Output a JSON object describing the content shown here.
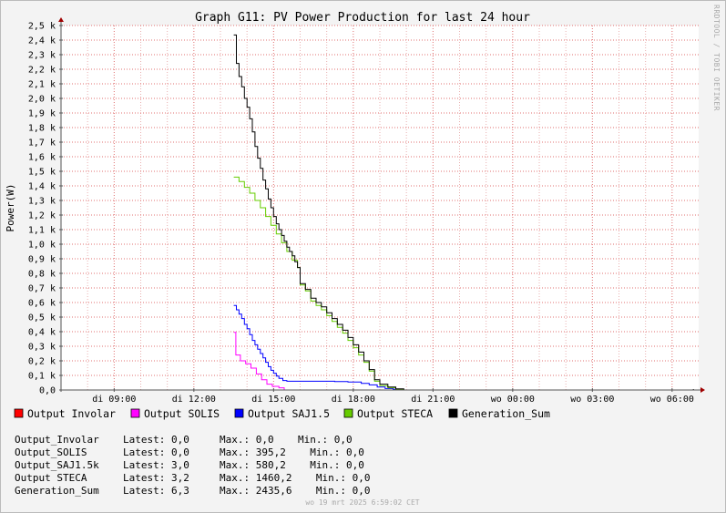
{
  "chart_data": {
    "type": "line",
    "title": "Graph G11: PV Power Production for last 24 hour",
    "ylabel": "Power(W)",
    "xlabel": "",
    "ylim": [
      0,
      2500
    ],
    "y_ticks": [
      0,
      100,
      200,
      300,
      400,
      500,
      600,
      700,
      800,
      900,
      1000,
      1100,
      1200,
      1300,
      1400,
      1500,
      1600,
      1700,
      1800,
      1900,
      2000,
      2100,
      2200,
      2300,
      2400,
      2500
    ],
    "y_tick_labels": [
      "0,0",
      "0,1 k",
      "0,2 k",
      "0,3 k",
      "0,4 k",
      "0,5 k",
      "0,6 k",
      "0,7 k",
      "0,8 k",
      "0,9 k",
      "1,0 k",
      "1,1 k",
      "1,2 k",
      "1,3 k",
      "1,4 k",
      "1,5 k",
      "1,6 k",
      "1,7 k",
      "1,8 k",
      "1,9 k",
      "2,0 k",
      "2,1 k",
      "2,2 k",
      "2,3 k",
      "2,4 k",
      "2,5 k"
    ],
    "x_unit": "hours since di 07:00",
    "xlim": [
      0,
      24
    ],
    "x_ticks": [
      2,
      5,
      8,
      11,
      14,
      17,
      20,
      23
    ],
    "x_tick_labels": [
      "di 09:00",
      "di 12:00",
      "di 15:00",
      "di 18:00",
      "di 21:00",
      "wo 00:00",
      "wo 03:00",
      "wo 06:00"
    ],
    "grid": true,
    "legend_position": "bottom",
    "series": [
      {
        "name": "Output_Involar",
        "color": "#ff0000",
        "points": [
          [
            6.5,
            0
          ],
          [
            24,
            0
          ]
        ]
      },
      {
        "name": "Output SOLIS",
        "color": "#ff00ff",
        "points": [
          [
            6.5,
            395
          ],
          [
            6.58,
            240
          ],
          [
            6.75,
            200
          ],
          [
            6.95,
            180
          ],
          [
            7.15,
            150
          ],
          [
            7.35,
            110
          ],
          [
            7.55,
            70
          ],
          [
            7.75,
            40
          ],
          [
            7.95,
            25
          ],
          [
            8.2,
            15
          ],
          [
            8.4,
            0
          ]
        ]
      },
      {
        "name": "Output SAJ1.5",
        "color": "#0000ff",
        "points": [
          [
            6.5,
            580
          ],
          [
            6.6,
            550
          ],
          [
            6.7,
            520
          ],
          [
            6.8,
            490
          ],
          [
            6.9,
            450
          ],
          [
            7.0,
            420
          ],
          [
            7.1,
            380
          ],
          [
            7.2,
            340
          ],
          [
            7.3,
            310
          ],
          [
            7.4,
            280
          ],
          [
            7.5,
            250
          ],
          [
            7.6,
            220
          ],
          [
            7.7,
            190
          ],
          [
            7.8,
            160
          ],
          [
            7.9,
            135
          ],
          [
            8.0,
            115
          ],
          [
            8.1,
            95
          ],
          [
            8.2,
            80
          ],
          [
            8.35,
            65
          ],
          [
            8.5,
            60
          ],
          [
            9.5,
            60
          ],
          [
            10.3,
            58
          ],
          [
            10.8,
            55
          ],
          [
            11.3,
            45
          ],
          [
            11.6,
            35
          ],
          [
            11.9,
            20
          ],
          [
            12.2,
            10
          ],
          [
            12.5,
            5
          ],
          [
            12.8,
            0
          ]
        ]
      },
      {
        "name": "Output STECA",
        "color": "#66cc00",
        "points": [
          [
            6.5,
            1460
          ],
          [
            6.7,
            1430
          ],
          [
            6.9,
            1390
          ],
          [
            7.1,
            1350
          ],
          [
            7.3,
            1300
          ],
          [
            7.5,
            1250
          ],
          [
            7.7,
            1190
          ],
          [
            7.9,
            1130
          ],
          [
            8.1,
            1070
          ],
          [
            8.3,
            1010
          ],
          [
            8.5,
            950
          ],
          [
            8.7,
            890
          ],
          [
            8.9,
            840
          ],
          [
            9.0,
            720
          ],
          [
            9.2,
            680
          ],
          [
            9.4,
            610
          ],
          [
            9.6,
            580
          ],
          [
            9.8,
            550
          ],
          [
            10.0,
            510
          ],
          [
            10.2,
            470
          ],
          [
            10.4,
            430
          ],
          [
            10.6,
            390
          ],
          [
            10.8,
            340
          ],
          [
            11.0,
            290
          ],
          [
            11.2,
            240
          ],
          [
            11.4,
            190
          ],
          [
            11.6,
            130
          ],
          [
            11.8,
            60
          ],
          [
            12.0,
            30
          ],
          [
            12.3,
            15
          ],
          [
            12.6,
            5
          ],
          [
            12.9,
            0
          ]
        ]
      },
      {
        "name": "Generation_Sum",
        "color": "#000000",
        "points": [
          [
            6.5,
            2435
          ],
          [
            6.6,
            2240
          ],
          [
            6.7,
            2150
          ],
          [
            6.8,
            2080
          ],
          [
            6.9,
            2000
          ],
          [
            7.0,
            1940
          ],
          [
            7.1,
            1860
          ],
          [
            7.2,
            1770
          ],
          [
            7.3,
            1670
          ],
          [
            7.4,
            1590
          ],
          [
            7.5,
            1520
          ],
          [
            7.6,
            1440
          ],
          [
            7.7,
            1380
          ],
          [
            7.8,
            1310
          ],
          [
            7.9,
            1250
          ],
          [
            8.0,
            1190
          ],
          [
            8.1,
            1140
          ],
          [
            8.2,
            1100
          ],
          [
            8.3,
            1060
          ],
          [
            8.4,
            1020
          ],
          [
            8.5,
            980
          ],
          [
            8.6,
            950
          ],
          [
            8.7,
            920
          ],
          [
            8.8,
            880
          ],
          [
            8.9,
            840
          ],
          [
            9.0,
            730
          ],
          [
            9.2,
            690
          ],
          [
            9.4,
            630
          ],
          [
            9.6,
            600
          ],
          [
            9.8,
            570
          ],
          [
            10.0,
            530
          ],
          [
            10.2,
            490
          ],
          [
            10.4,
            450
          ],
          [
            10.6,
            410
          ],
          [
            10.8,
            360
          ],
          [
            11.0,
            310
          ],
          [
            11.2,
            260
          ],
          [
            11.4,
            200
          ],
          [
            11.6,
            140
          ],
          [
            11.8,
            70
          ],
          [
            12.0,
            40
          ],
          [
            12.3,
            20
          ],
          [
            12.6,
            8
          ],
          [
            12.9,
            0
          ],
          [
            23.5,
            0
          ],
          [
            23.8,
            6.3
          ]
        ]
      }
    ]
  },
  "legend": [
    {
      "label": "Output Involar",
      "color": "#ff0000"
    },
    {
      "label": "Output SOLIS",
      "color": "#ff00ff"
    },
    {
      "label": "Output SAJ1.5",
      "color": "#0000ff"
    },
    {
      "label": "Output STECA",
      "color": "#66cc00"
    },
    {
      "label": "Generation_Sum",
      "color": "#000000"
    }
  ],
  "stats": [
    {
      "name": "Output_Involar",
      "latest": "0,0",
      "max": "0,0",
      "min": "0,0"
    },
    {
      "name": "Output_SOLIS",
      "latest": "0,0",
      "max": "395,2",
      "min": "0,0"
    },
    {
      "name": "Output_SAJ1.5k",
      "latest": "3,0",
      "max": "580,2",
      "min": "0,0"
    },
    {
      "name": "Output STECA",
      "latest": "3,2",
      "max": "1460,2",
      "min": "0,0"
    },
    {
      "name": "Generation_Sum",
      "latest": "6,3",
      "max": "2435,6",
      "min": "0,0"
    }
  ],
  "stats_labels": {
    "latest": "Latest:",
    "max": "Max.:",
    "min": "Min.:"
  },
  "watermark": "RRDTOOL / TOBI OETIKER",
  "footer": "wo 19 mrt 2025  6:59:02 CET"
}
